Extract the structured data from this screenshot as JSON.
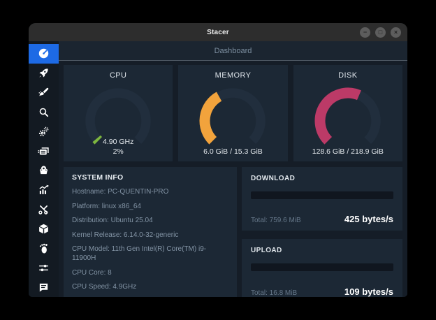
{
  "window": {
    "title": "Stacer",
    "controls": [
      {
        "id": "minimize",
        "glyph": "−"
      },
      {
        "id": "maximize",
        "glyph": "□"
      },
      {
        "id": "close",
        "glyph": "×"
      }
    ]
  },
  "header": {
    "title": "Dashboard"
  },
  "sidebar": {
    "items": [
      {
        "id": "dashboard",
        "icon": "dashboard-icon",
        "active": true
      },
      {
        "id": "startup-apps",
        "icon": "rocket-icon",
        "active": false
      },
      {
        "id": "system-cleaner",
        "icon": "brush-icon",
        "active": false
      },
      {
        "id": "search",
        "icon": "search-icon",
        "active": false
      },
      {
        "id": "services",
        "icon": "gears-icon",
        "active": false
      },
      {
        "id": "processes",
        "icon": "processes-icon",
        "active": false
      },
      {
        "id": "uninstaller",
        "icon": "uninstaller-icon",
        "active": false
      },
      {
        "id": "resources",
        "icon": "chart-icon",
        "active": false
      },
      {
        "id": "helpers",
        "icon": "tools-icon",
        "active": false
      },
      {
        "id": "apt-repository-manager",
        "icon": "package-icon",
        "active": false
      },
      {
        "id": "gnome-settings",
        "icon": "gnome-foot-icon",
        "active": false
      },
      {
        "id": "settings",
        "icon": "sliders-icon",
        "active": false
      },
      {
        "id": "feedback",
        "icon": "chat-icon",
        "active": false
      }
    ]
  },
  "gauges": [
    {
      "id": "cpu",
      "name": "CPU",
      "percent": 2,
      "color": "#7eb73f",
      "lines": [
        "4.90 GHz",
        "2%"
      ]
    },
    {
      "id": "memory",
      "name": "MEMORY",
      "percent": 39.2,
      "color": "#f2a33c",
      "lines": [
        "6.0 GiB / 15.3 GiB"
      ]
    },
    {
      "id": "disk",
      "name": "DISK",
      "percent": 58.7,
      "color": "#bc3a67",
      "lines": [
        "128.6 GiB / 218.9 GiB"
      ]
    }
  ],
  "system_info": {
    "title": "SYSTEM INFO",
    "rows": [
      {
        "label": "Hostname",
        "value": "PC-QUENTIN-PRO"
      },
      {
        "label": "Platform",
        "value": "linux x86_64"
      },
      {
        "label": "Distribution",
        "value": "Ubuntu 25.04"
      },
      {
        "label": "Kernel Release",
        "value": "6.14.0-32-generic"
      },
      {
        "label": "CPU Model",
        "value": "11th Gen Intel(R) Core(TM) i9-11900H"
      },
      {
        "label": "CPU Core",
        "value": "8"
      },
      {
        "label": "CPU Speed",
        "value": "4.9GHz"
      }
    ]
  },
  "network": [
    {
      "id": "download",
      "title": "DOWNLOAD",
      "total": "Total: 759.6 MiB",
      "speed": "425 bytes/s",
      "progress_percent": 0
    },
    {
      "id": "upload",
      "title": "UPLOAD",
      "total": "Total: 16.8 MiB",
      "speed": "109 bytes/s",
      "progress_percent": 0
    }
  ],
  "colors": {
    "accent_blue": "#1d6ae5",
    "cpu_green": "#7eb73f",
    "memory_orange": "#f2a33c",
    "disk_pink": "#bc3a67",
    "gauge_track": "#212e3d"
  }
}
